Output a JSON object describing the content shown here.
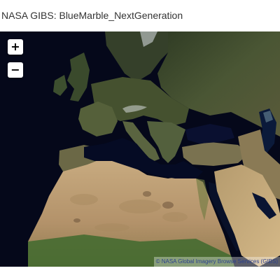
{
  "header": {
    "title": "NASA GIBS: BlueMarble_NextGeneration"
  },
  "map": {
    "layer": "BlueMarble_NextGeneration",
    "controls": {
      "zoom_in_label": "+",
      "zoom_out_label": "−"
    },
    "attribution": "© NASA Global Imagery Browse Services (GIBS)"
  },
  "colors": {
    "ocean": "#05081a",
    "europe_land": "#3e4a2e",
    "sahara": "#b89a70",
    "sahel": "#3f6a2e",
    "arabia": "#c4a678",
    "ice": "#d8dde0",
    "attribution_text": "#2a3f8f"
  }
}
